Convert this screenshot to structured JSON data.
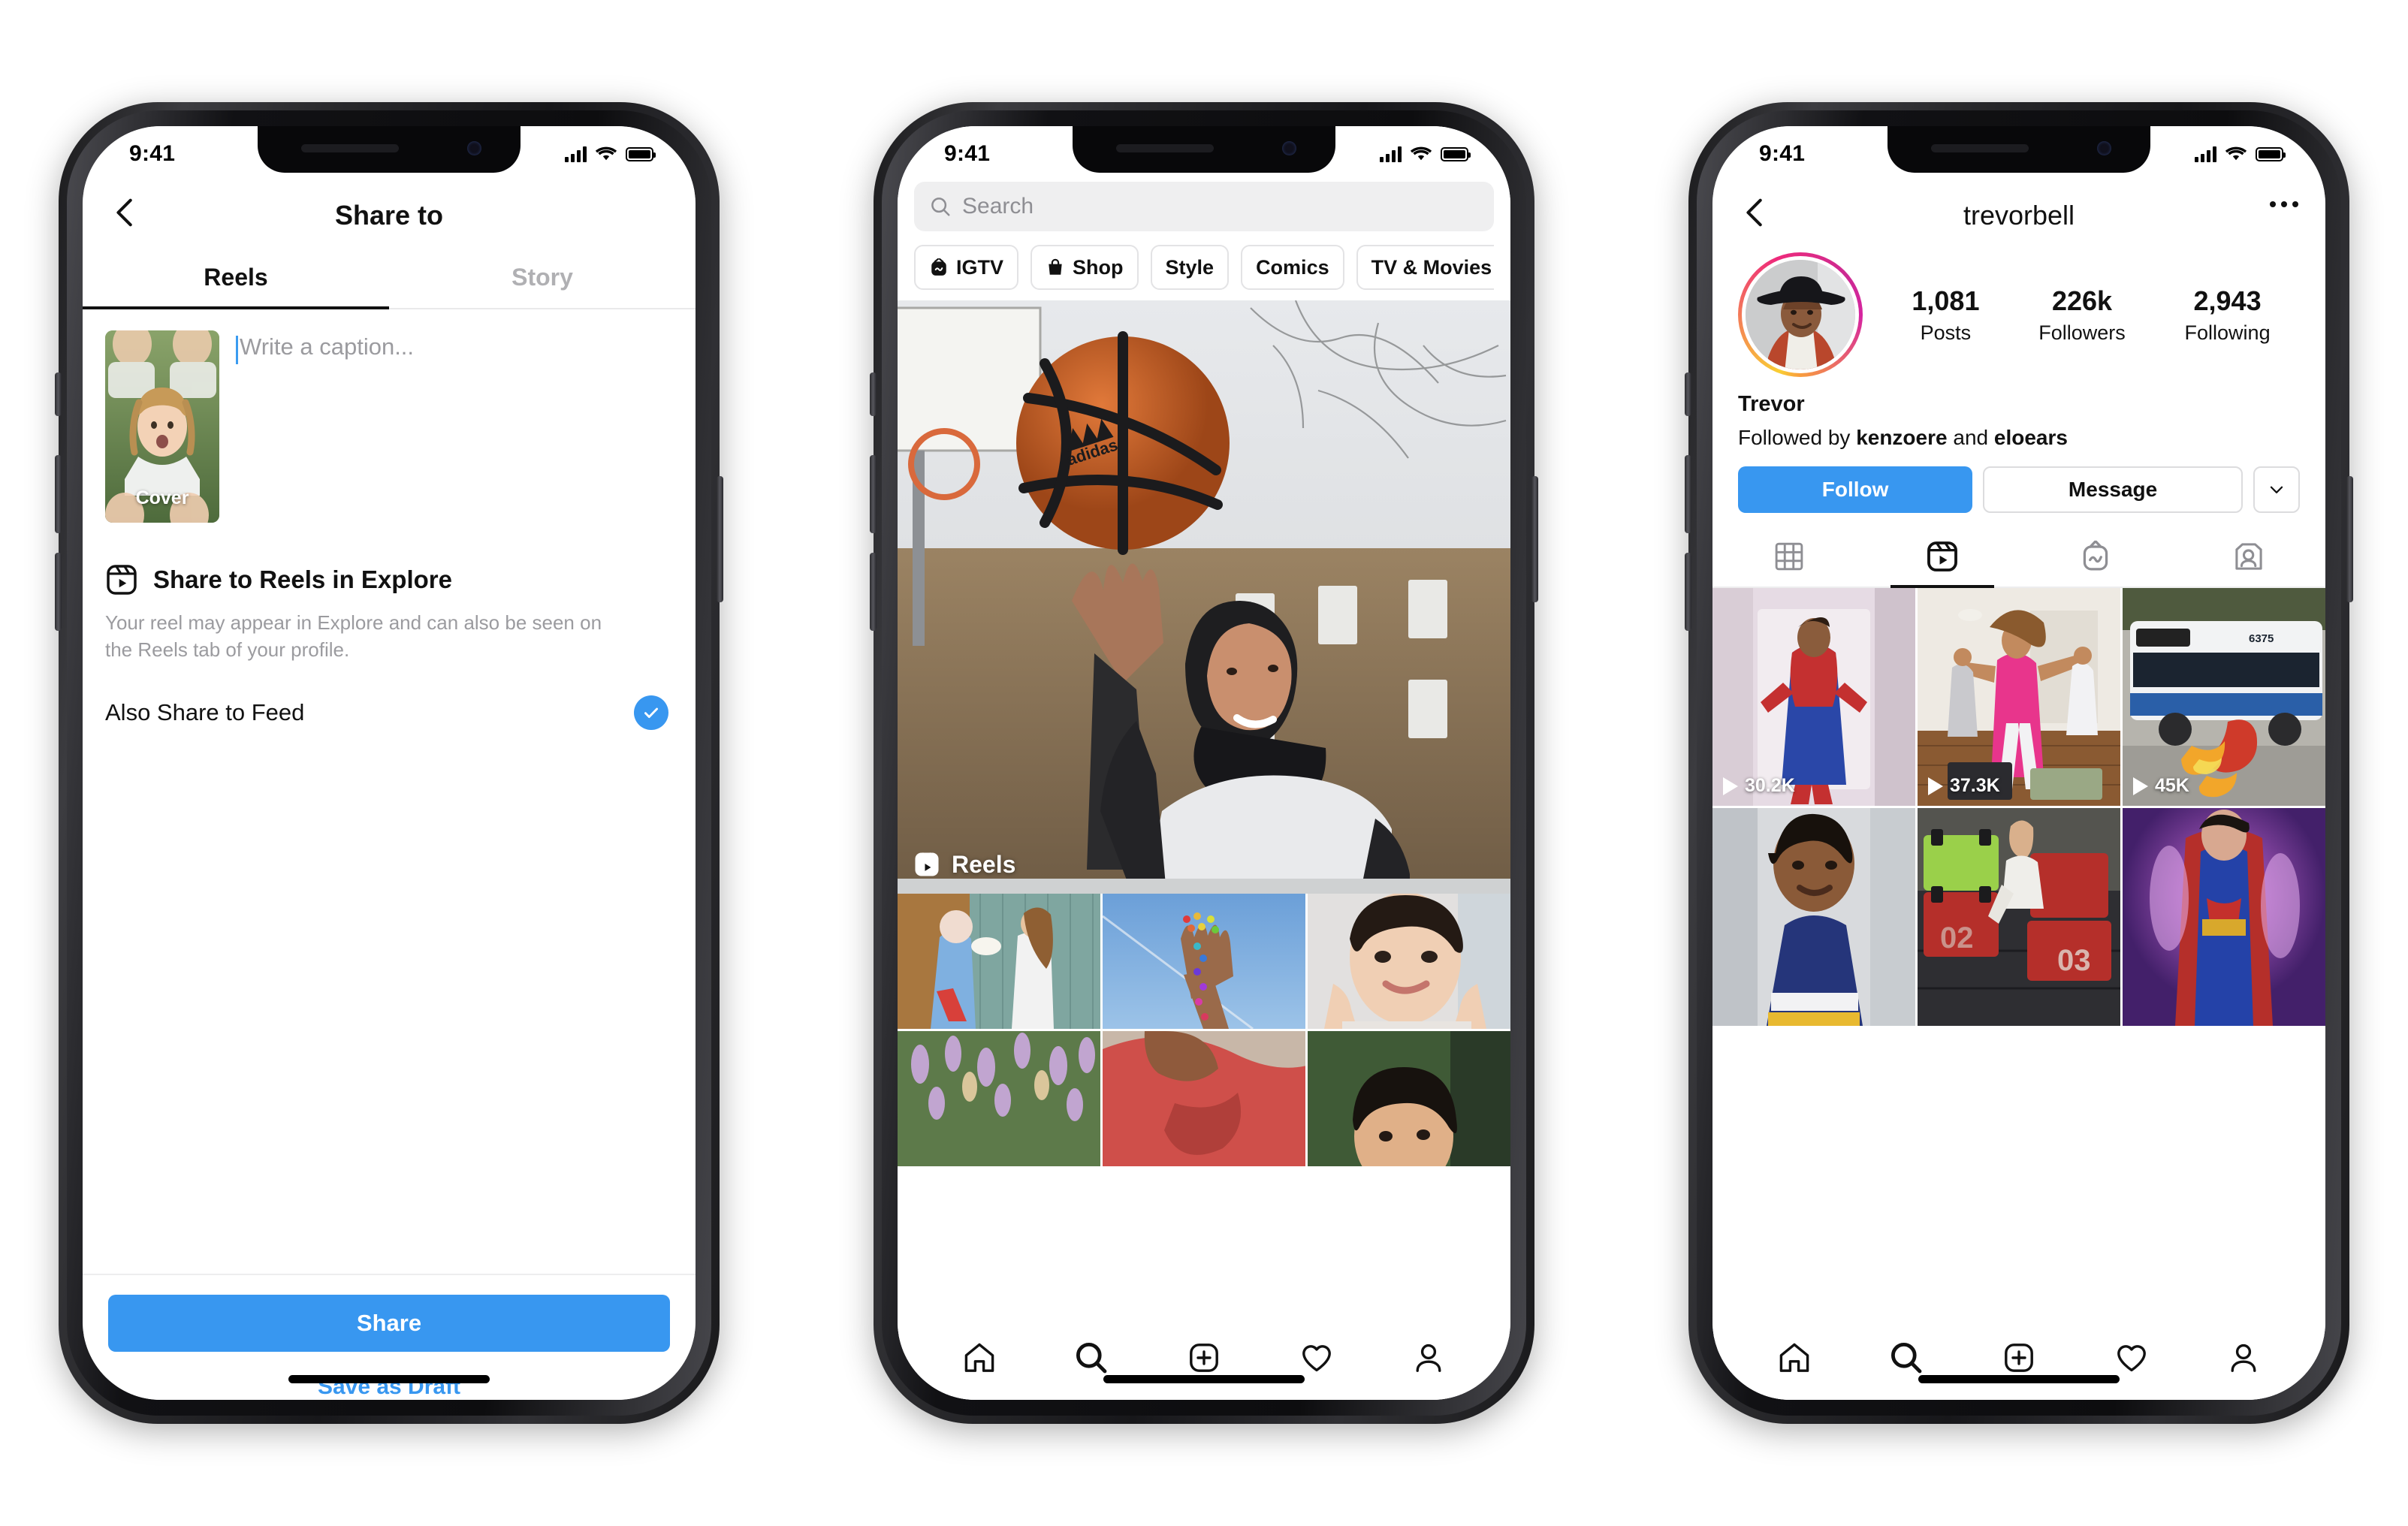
{
  "status_bar": {
    "time": "9:41",
    "signal_icon": "cellular-bars-icon",
    "wifi_icon": "wifi-icon",
    "battery_icon": "battery-icon"
  },
  "colors": {
    "accent_blue": "#3897f0",
    "text_primary": "#111111",
    "text_muted": "#9b9b9f",
    "chip_border": "#e3e3e5"
  },
  "phone1": {
    "nav": {
      "back_icon": "chevron-left-icon",
      "title": "Share to"
    },
    "tabs": [
      {
        "label": "Reels",
        "active": true
      },
      {
        "label": "Story",
        "active": false
      }
    ],
    "caption": {
      "placeholder": "Write a caption...",
      "thumb_badge": "Cover"
    },
    "explore": {
      "icon": "reels-icon",
      "title": "Share to Reels in Explore",
      "description": "Your reel may appear in Explore and can also be seen on the Reels tab of your profile."
    },
    "feed_row": {
      "label": "Also Share to Feed",
      "checked": true,
      "check_icon": "check-icon"
    },
    "footer": {
      "share_label": "Share",
      "draft_label": "Save as Draft"
    }
  },
  "phone2": {
    "search": {
      "placeholder": "Search",
      "icon": "search-icon"
    },
    "chips": [
      {
        "label": "IGTV",
        "icon": "igtv-icon"
      },
      {
        "label": "Shop",
        "icon": "shop-bag-icon"
      },
      {
        "label": "Style",
        "icon": ""
      },
      {
        "label": "Comics",
        "icon": ""
      },
      {
        "label": "TV & Movies",
        "icon": ""
      }
    ],
    "hero": {
      "badge_label": "Reels",
      "badge_icon": "reels-icon",
      "alt": "woman in hijab spinning a basketball on a court"
    },
    "grid": [
      {
        "alt": "couple pie in face prank"
      },
      {
        "alt": "rainbow beaded hand against blue sky"
      },
      {
        "alt": "woman smiling hands on cheeks"
      },
      {
        "alt": "purple wildflower field"
      },
      {
        "alt": "person in red hoodie"
      },
      {
        "alt": "person outdoors portrait"
      }
    ],
    "navbar": [
      {
        "icon": "home-icon",
        "active": false
      },
      {
        "icon": "search-icon",
        "active": true
      },
      {
        "icon": "plus-square-icon",
        "active": false
      },
      {
        "icon": "heart-icon",
        "active": false
      },
      {
        "icon": "profile-icon",
        "active": false
      }
    ]
  },
  "phone3": {
    "nav": {
      "back_icon": "chevron-left-icon",
      "username": "trevorbell",
      "more_icon": "more-options-icon"
    },
    "avatar": {
      "has_story_ring": true,
      "alt": "man in black cowboy hat and red shirt"
    },
    "stats": [
      {
        "value": "1,081",
        "label": "Posts"
      },
      {
        "value": "226k",
        "label": "Followers"
      },
      {
        "value": "2,943",
        "label": "Following"
      }
    ],
    "display_name": "Trevor",
    "followed_by": {
      "prefix": "Followed by ",
      "first": "kenzoere",
      "middle": " and ",
      "second": "eloears"
    },
    "actions": {
      "follow_label": "Follow",
      "message_label": "Message",
      "chevron_icon": "chevron-down-icon"
    },
    "tabs": [
      {
        "icon": "grid-icon",
        "active": false
      },
      {
        "icon": "reels-icon",
        "active": true
      },
      {
        "icon": "igtv-icon",
        "active": false
      },
      {
        "icon": "tagged-icon",
        "active": false
      }
    ],
    "reels": [
      {
        "views": "30.2K",
        "play_icon": "play-icon",
        "alt": "man in spiderman suit in hallway"
      },
      {
        "views": "37.3K",
        "play_icon": "play-icon",
        "alt": "group workout dance in apartment"
      },
      {
        "views": "45K",
        "play_icon": "play-icon",
        "alt": "flash superhero running past city bus"
      },
      {
        "views": "",
        "play_icon": "play-icon",
        "alt": "man in navy tee talking to camera"
      },
      {
        "views": "",
        "play_icon": "play-icon",
        "alt": "man jumping over plyo boxes in gym"
      },
      {
        "views": "",
        "play_icon": "play-icon",
        "alt": "superman costume glowing"
      }
    ],
    "navbar": [
      {
        "icon": "home-icon",
        "active": false
      },
      {
        "icon": "search-icon",
        "active": true
      },
      {
        "icon": "plus-square-icon",
        "active": false
      },
      {
        "icon": "heart-icon",
        "active": false
      },
      {
        "icon": "profile-icon",
        "active": false
      }
    ]
  }
}
